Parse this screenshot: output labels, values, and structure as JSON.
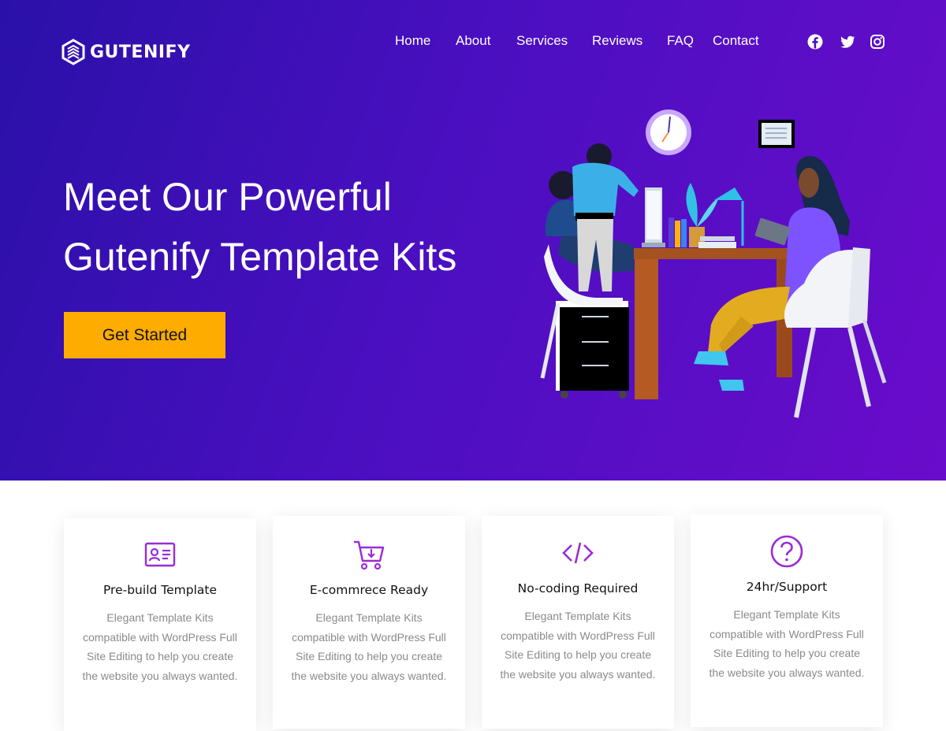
{
  "brand": {
    "name": "GUTENIFY"
  },
  "nav": {
    "items": [
      {
        "label": "Home"
      },
      {
        "label": "About"
      },
      {
        "label": "Services"
      },
      {
        "label": "Reviews"
      },
      {
        "label": "FAQ"
      },
      {
        "label": "Contact"
      }
    ]
  },
  "social": {
    "icons": [
      "facebook-icon",
      "twitter-icon",
      "instagram-icon"
    ]
  },
  "hero": {
    "title_line1": "Meet Our Powerful",
    "title_line2": "Gutenify Template Kits",
    "cta_label": "Get Started"
  },
  "features": [
    {
      "icon": "id-card-icon",
      "title": "Pre-build Template",
      "description": "Elegant Template Kits compatible with WordPress Full Site Editing to help you create the website you always wanted."
    },
    {
      "icon": "cart-icon",
      "title": "E-commrece Ready",
      "description": "Elegant Template Kits compatible with WordPress Full Site Editing to help you create the website you always wanted."
    },
    {
      "icon": "code-icon",
      "title": "No-coding Required",
      "description": "Elegant Template Kits compatible with WordPress Full Site Editing to help you create the website you always wanted."
    },
    {
      "icon": "question-icon",
      "title": "24hr/Support",
      "description": "Elegant Template Kits compatible with WordPress Full Site Editing to help you create the website you always wanted."
    }
  ],
  "colors": {
    "hero_gradient_start": "#2a10a8",
    "hero_gradient_end": "#6a0ccb",
    "cta": "#ffac00",
    "icon_accent": "#9a2bd6"
  }
}
